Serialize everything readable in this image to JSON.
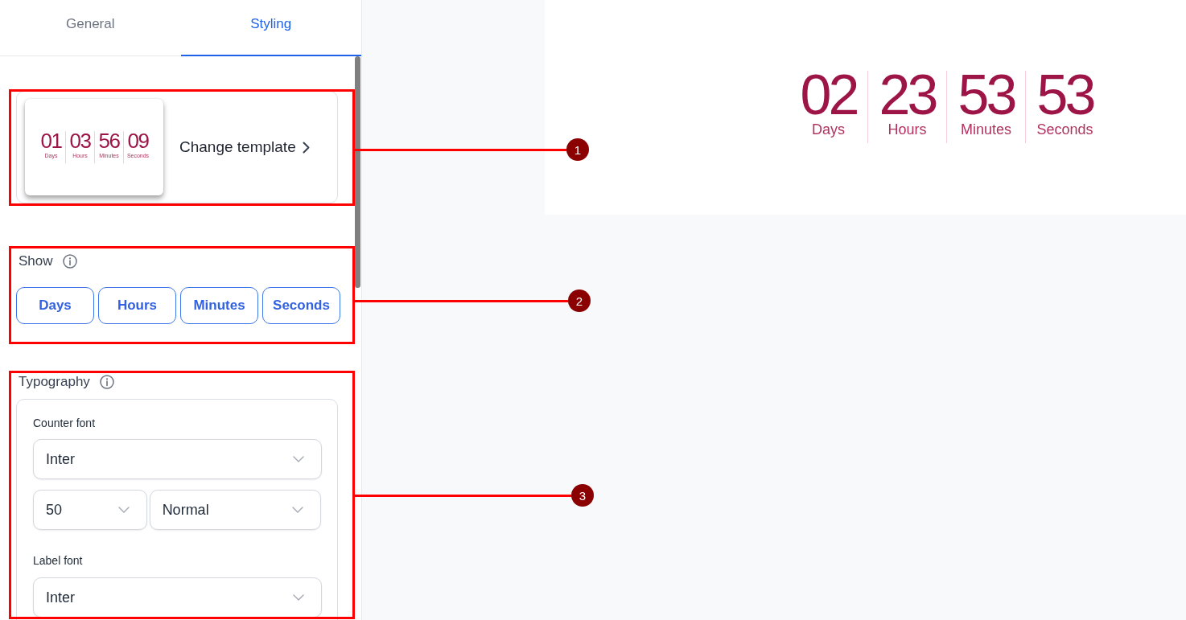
{
  "tabs": [
    {
      "label": "General",
      "selected": false
    },
    {
      "label": "Styling",
      "selected": true
    }
  ],
  "template_card": {
    "preview_units": [
      {
        "value": "01",
        "label": "Days"
      },
      {
        "value": "03",
        "label": "Hours"
      },
      {
        "value": "56",
        "label": "Minutes"
      },
      {
        "value": "09",
        "label": "Seconds"
      }
    ],
    "action": "Change template"
  },
  "show": {
    "title": "Show",
    "options": [
      {
        "label": "Days",
        "selected": true
      },
      {
        "label": "Hours",
        "selected": true
      },
      {
        "label": "Minutes",
        "selected": true
      },
      {
        "label": "Seconds",
        "selected": true
      }
    ]
  },
  "typography": {
    "title": "Typography",
    "counter_font": {
      "label": "Counter font",
      "family": "Inter",
      "size": "50",
      "weight": "Normal"
    },
    "label_font": {
      "label": "Label font",
      "family": "Inter"
    }
  },
  "preview": {
    "units": [
      {
        "value": "02",
        "label": "Days"
      },
      {
        "value": "23",
        "label": "Hours"
      },
      {
        "value": "53",
        "label": "Minutes"
      },
      {
        "value": "53",
        "label": "Seconds"
      }
    ]
  },
  "callouts": [
    {
      "number": "1"
    },
    {
      "number": "2"
    },
    {
      "number": "3"
    }
  ]
}
